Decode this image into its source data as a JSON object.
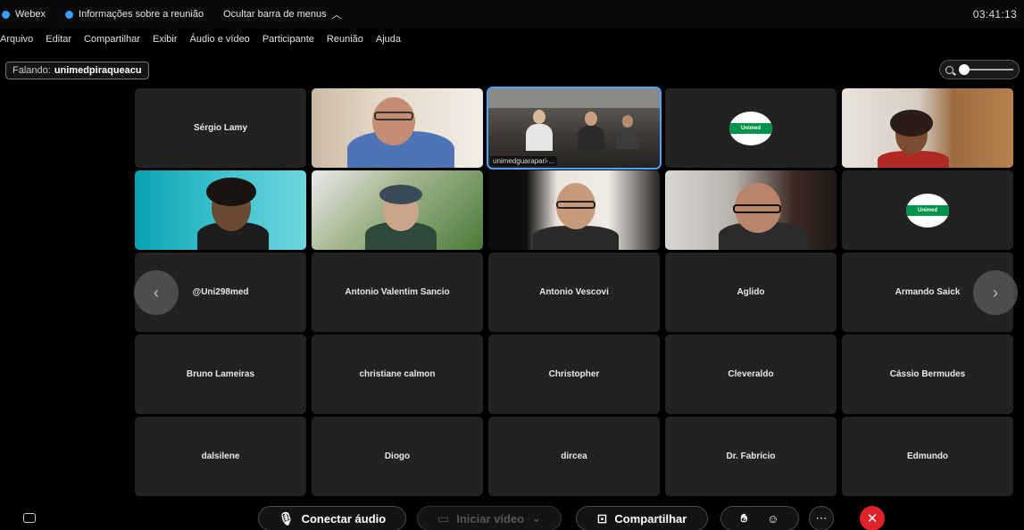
{
  "titlebar": {
    "app_name": "Webex",
    "meeting_info": "Informações sobre a reunião",
    "hide_menu": "Ocultar barra de menus",
    "clock": "03:41:13"
  },
  "menu": [
    "Arquivo",
    "Editar",
    "Compartilhar",
    "Exibir",
    "Áudio e vídeo",
    "Participante",
    "Reunião",
    "Ajuda"
  ],
  "speaking": {
    "label": "Falando:",
    "name": "unimedpiraqueacu"
  },
  "participants": {
    "row1": [
      {
        "name": "Sérgio Lamy",
        "type": "name"
      },
      {
        "name": "",
        "type": "video"
      },
      {
        "name": "unimedguarapari-...",
        "type": "video"
      },
      {
        "name": "",
        "type": "logo"
      },
      {
        "name": "",
        "type": "video"
      }
    ],
    "row2": [
      {
        "name": "",
        "type": "video"
      },
      {
        "name": "",
        "type": "video"
      },
      {
        "name": "",
        "type": "video"
      },
      {
        "name": "",
        "type": "video"
      },
      {
        "name": "",
        "type": "logo"
      }
    ],
    "row3": [
      "@Uni298med",
      "Antonio Valentim Sancio",
      "Antonio Vescovi",
      "Aglido",
      "Armando Saick"
    ],
    "row4": [
      "Bruno Lameiras",
      "christiane calmon",
      "Christopher",
      "Cleveraldo",
      "Cássio Bermudes"
    ],
    "row5": [
      "dalsilene",
      "Diogo",
      "dircea",
      "Dr. Fabrício",
      "Edmundo"
    ]
  },
  "logo_text": "Unimed",
  "controls": {
    "audio": "Conectar áudio",
    "video": "Iniciar vídeo",
    "share": "Compartilhar"
  },
  "colors": {
    "accent": "#4aa3ff",
    "end_call": "#e0232b",
    "unimed_green": "#00934a",
    "tile_bg": "#222222"
  }
}
